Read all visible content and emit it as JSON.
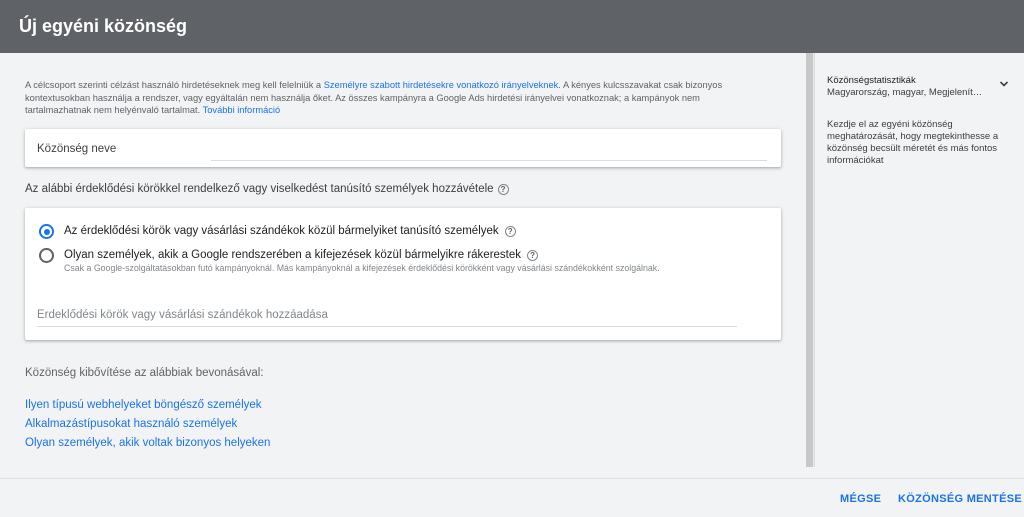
{
  "header": {
    "title": "Új egyéni közönség"
  },
  "policy": {
    "text_before": "A célcsoport szerinti célzást használó hirdetéseknek meg kell felelniük a ",
    "link_policy": "Személyre szabott hirdetésekre vonatkozó irányelveknek",
    "text_after": ". A kényes kulcsszavakat csak bizonyos kontextusokban használja a rendszer, vagy egyáltalán nem használja őket. Az összes kampányra a Google Ads hirdetési irányelvei vonatkoznak; a kampányok nem tartalmazhatnak nem helyénvaló tartalmat. ",
    "link_more": "További információ"
  },
  "audience_name": {
    "label": "Közönség neve",
    "value": ""
  },
  "section": {
    "label": "Az alábbi érdeklődési körökkel rendelkező vagy viselkedést tanúsító személyek hozzávétele"
  },
  "radios": [
    {
      "label": "Az érdeklődési körök vagy vásárlási szándékok közül bármelyiket tanúsító személyek",
      "checked": true
    },
    {
      "label": "Olyan személyek, akik a Google rendszerében a kifejezések közül bármelyikre rákerestek",
      "checked": false,
      "sub": "Csak a Google-szolgáltatásokban futó kampányoknál. Más kampányoknál a kifejezések érdeklődési körökként vagy vásárlási szándékokként szolgálnak."
    }
  ],
  "interest_input": {
    "placeholder": "Érdeklődési körök vagy vásárlási szándékok hozzáadása"
  },
  "expand": {
    "label": "Közönség kibővítése az alábbiak bevonásával:",
    "links": [
      "Ilyen típusú webhelyeket böngésző személyek",
      "Alkalmazástípusokat használó személyek",
      "Olyan személyek, akik voltak bizonyos helyeken"
    ]
  },
  "side": {
    "title": "Közönségstatisztikák",
    "subtitle": "Magyarország, magyar, Megjelenít…",
    "description": "Kezdje el az egyéni közönség meghatározását, hogy megtekinthesse a közönség becsült méretét és más fontos információkat"
  },
  "footer": {
    "cancel": "MÉGSE",
    "save": "KÖZÖNSÉG MENTÉSE"
  },
  "colors": {
    "accent": "#1a73e8",
    "header": "#5f6368"
  }
}
